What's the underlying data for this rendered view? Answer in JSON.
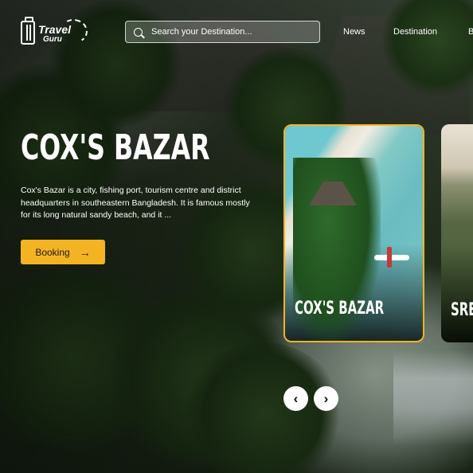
{
  "brand": {
    "line1": "Travel",
    "line2": "Guru"
  },
  "search": {
    "placeholder": "Search your Destination..."
  },
  "nav": [
    "News",
    "Destination",
    "B"
  ],
  "hero": {
    "title": "COX'S BAZAR",
    "description": "Cox's Bazar is a city, fishing port, tourism centre and district headquarters in southeastern Bangladesh. It is famous mostly for its long natural sandy beach, and it ...",
    "button_label": "Booking"
  },
  "cards": [
    {
      "label": "COX'S BAZAR",
      "active": true
    },
    {
      "label": "SRE",
      "active": false
    }
  ],
  "controls": {
    "prev": "‹",
    "next": "›"
  },
  "colors": {
    "accent": "#f4b323"
  }
}
